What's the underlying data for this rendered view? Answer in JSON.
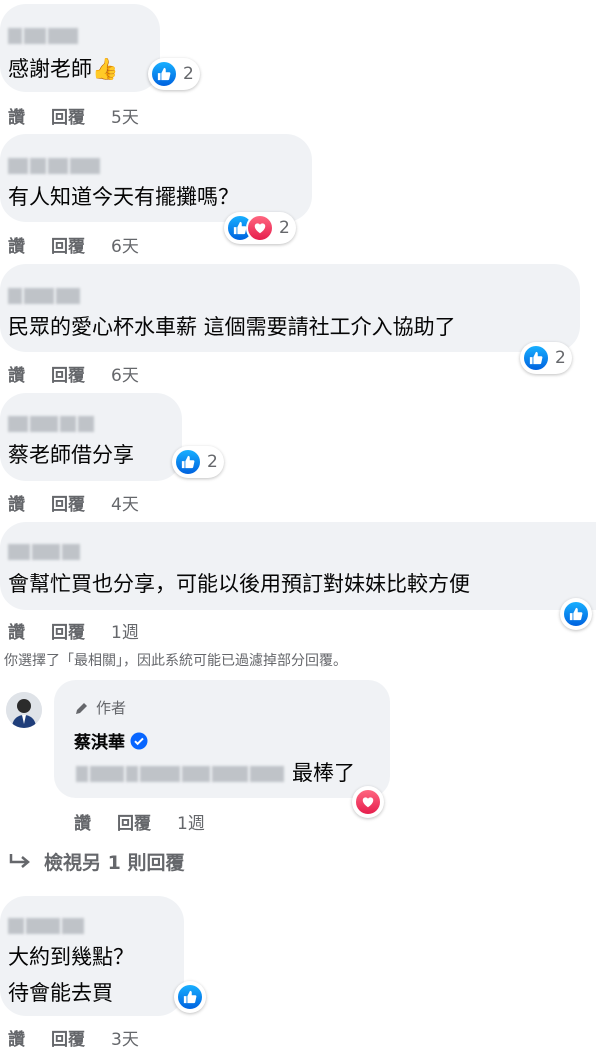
{
  "actions": {
    "like": "讚",
    "reply": "回覆"
  },
  "comments": [
    {
      "text": "感謝老師👍",
      "reaction_count": "2",
      "time": "5天"
    },
    {
      "text": "有人知道今天有擺攤嗎？",
      "reaction_count": "2",
      "time": "6天"
    },
    {
      "text": "民眾的愛心杯水車薪 這個需要請社工介入協助了",
      "reaction_count": "2",
      "time": "6天"
    },
    {
      "text": "蔡老師借分享",
      "reaction_count": "2",
      "time": "4天"
    },
    {
      "text": "會幫忙買也分享，可能以後用預訂對妹妹比較方便",
      "reaction_count": "",
      "time": "1週"
    }
  ],
  "filter_note": "你選擇了「最相關」，因此系統可能已過濾掉部分回覆。",
  "reply": {
    "author_badge": "作者",
    "author_name": "蔡淇華",
    "text_suffix": "最棒了",
    "time": "1週"
  },
  "view_more": "檢視另 1 則回覆",
  "last_comment": {
    "line1": "大約到幾點？",
    "line2": "待會能去買",
    "time": "3天"
  },
  "colors": {
    "bubble": "#f0f2f5",
    "like_blue": "#0866ff",
    "love_red": "#e61e4d",
    "secondary_text": "#65676b",
    "verified": "#0866ff"
  },
  "icons": [
    "like-icon",
    "love-icon",
    "pencil-icon",
    "verified-icon",
    "reply-arrow-icon"
  ]
}
